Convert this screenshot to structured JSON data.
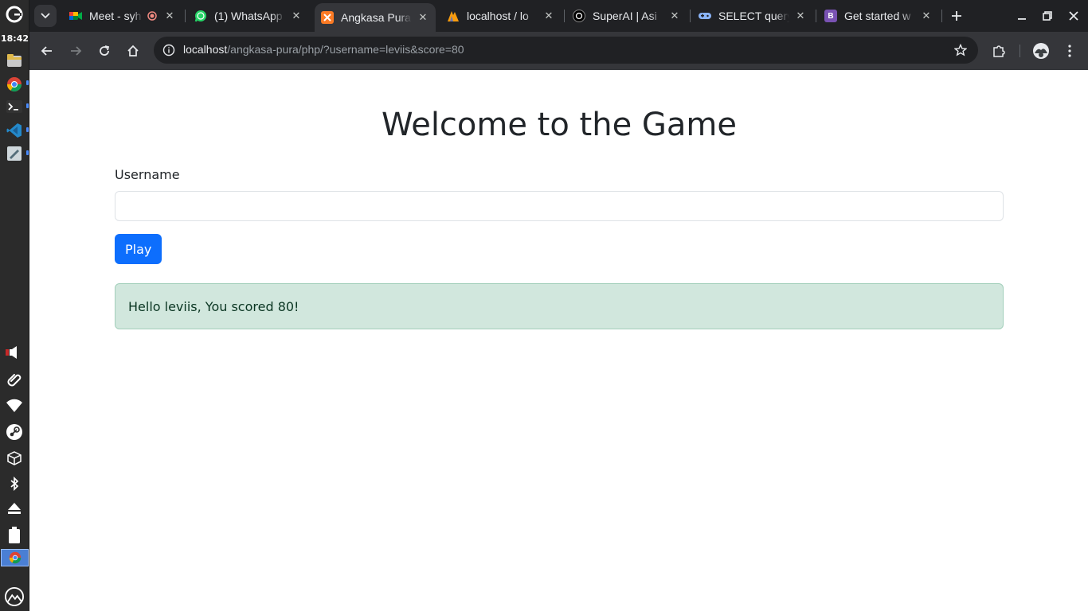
{
  "system": {
    "clock": "18:42",
    "dock_items": [
      "launcher-icon",
      "files-icon",
      "chrome-icon",
      "terminal-icon",
      "vscode-icon",
      "text-editor-icon",
      "volume-icon",
      "paperclip-icon",
      "wifi-icon",
      "steam-icon",
      "package-icon",
      "bluetooth-icon",
      "eject-icon",
      "battery-icon",
      "chrome-active-icon",
      "mountain-icon"
    ]
  },
  "tabs": [
    {
      "title": "Meet - syh",
      "favicon": "meet-icon",
      "color": "#34a853"
    },
    {
      "title": "(1) WhatsApp",
      "favicon": "whatsapp-icon",
      "color": "#25d366"
    },
    {
      "title": "Angkasa Pura",
      "favicon": "xampp-icon",
      "color": "#fb7a24"
    },
    {
      "title": "localhost / lo",
      "favicon": "phpmyadmin-icon",
      "color": "#f89c0e"
    },
    {
      "title": "SuperAI | Asi",
      "favicon": "superai-icon",
      "color": "#000000"
    },
    {
      "title": "SELECT query",
      "favicon": "gamepad-icon",
      "color": "#8ab4f8"
    },
    {
      "title": "Get started w",
      "favicon": "bootstrap-icon",
      "color": "#7952b3"
    }
  ],
  "toolbar": {
    "url_host": "localhost",
    "url_path": "/angkasa-pura/php/?username=leviis&score=80"
  },
  "page": {
    "title": "Welcome to the Game",
    "username_label": "Username",
    "username_value": "",
    "play_label": "Play",
    "alert_text": "Hello leviis, You scored 80!"
  }
}
